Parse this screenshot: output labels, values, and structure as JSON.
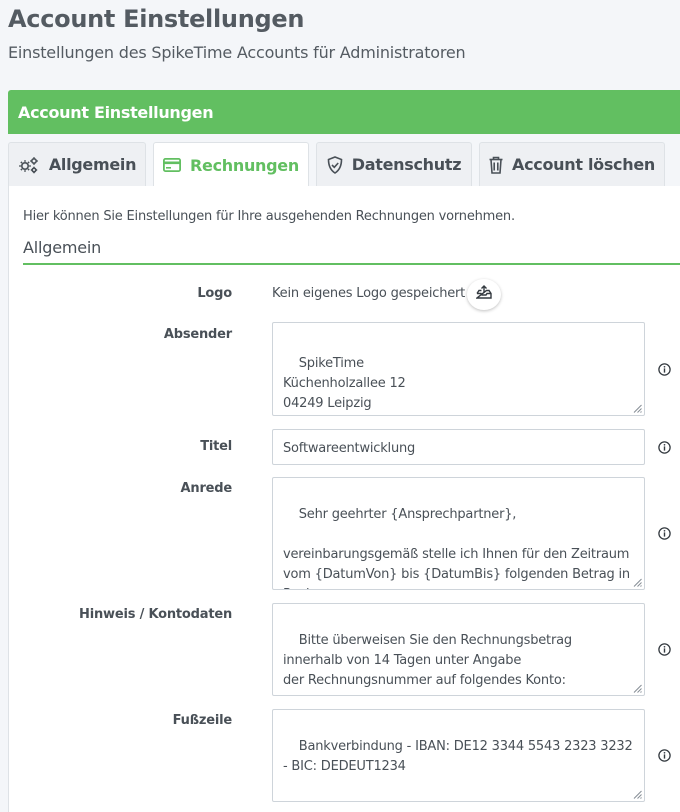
{
  "page": {
    "title": "Account Einstellungen",
    "subtitle": "Einstellungen des SpikeTime Accounts für Administratoren"
  },
  "card": {
    "header": "Account Einstellungen"
  },
  "tabs": [
    {
      "label": "Allgemein",
      "icon": "gears-icon",
      "active": false
    },
    {
      "label": "Rechnungen",
      "icon": "credit-card-icon",
      "active": true
    },
    {
      "label": "Datenschutz",
      "icon": "shield-icon",
      "active": false
    },
    {
      "label": "Account löschen",
      "icon": "trash-icon",
      "active": false
    }
  ],
  "content": {
    "intro": "Hier können Sie Einstellungen für Ihre ausgehenden Rechnungen vornehmen.",
    "section_title": "Allgemein",
    "logo": {
      "label": "Logo",
      "text": "Kein eigenes Logo gespeichert"
    },
    "absender": {
      "label": "Absender",
      "value": "SpikeTime\nKüchenholzallee 12\n04249 Leipzig"
    },
    "titel": {
      "label": "Titel",
      "value": "Softwareentwicklung"
    },
    "anrede": {
      "label": "Anrede",
      "value": "Sehr geehrter {Ansprechpartner},\n\nvereinbarungsgemäß stelle ich Ihnen für den Zeitraum vom {DatumVon} bis {DatumBis} folgenden Betrag in Rechnung:"
    },
    "hinweis": {
      "label": "Hinweis / Kontodaten",
      "value": "Bitte überweisen Sie den Rechnungsbetrag innerhalb von 14 Tagen unter Angabe\nder Rechnungsnummer auf folgendes Konto:"
    },
    "fusszeile": {
      "label": "Fußzeile",
      "value": "Bankverbindung - IBAN: DE12 3344 5543 2323 3232 - BIC: DEDEUT1234"
    }
  },
  "colors": {
    "accent": "#62bf61",
    "background": "#f4f6f9"
  }
}
